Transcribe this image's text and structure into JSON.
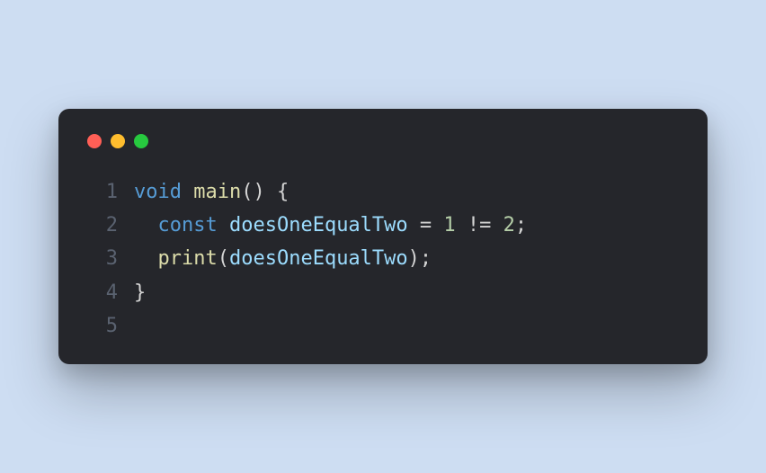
{
  "window": {
    "dots": [
      "red",
      "yellow",
      "green"
    ]
  },
  "code": {
    "lines": [
      {
        "n": "1"
      },
      {
        "n": "2"
      },
      {
        "n": "3"
      },
      {
        "n": "4"
      },
      {
        "n": "5"
      }
    ],
    "tokens": {
      "l1_void": "void",
      "l1_sp1": " ",
      "l1_main": "main",
      "l1_paren": "()",
      "l1_sp2": " ",
      "l1_brace": "{",
      "l2_indent": "  ",
      "l2_const": "const",
      "l2_sp1": " ",
      "l2_var": "doesOneEqualTwo",
      "l2_sp2": " ",
      "l2_eq": "=",
      "l2_sp3": " ",
      "l2_num1": "1",
      "l2_sp4": " ",
      "l2_ne": "!=",
      "l2_sp5": " ",
      "l2_num2": "2",
      "l2_semi": ";",
      "l3_indent": "  ",
      "l3_print": "print",
      "l3_open": "(",
      "l3_arg": "doesOneEqualTwo",
      "l3_close": ")",
      "l3_semi": ";",
      "l4_brace": "}",
      "l5_empty": ""
    }
  }
}
